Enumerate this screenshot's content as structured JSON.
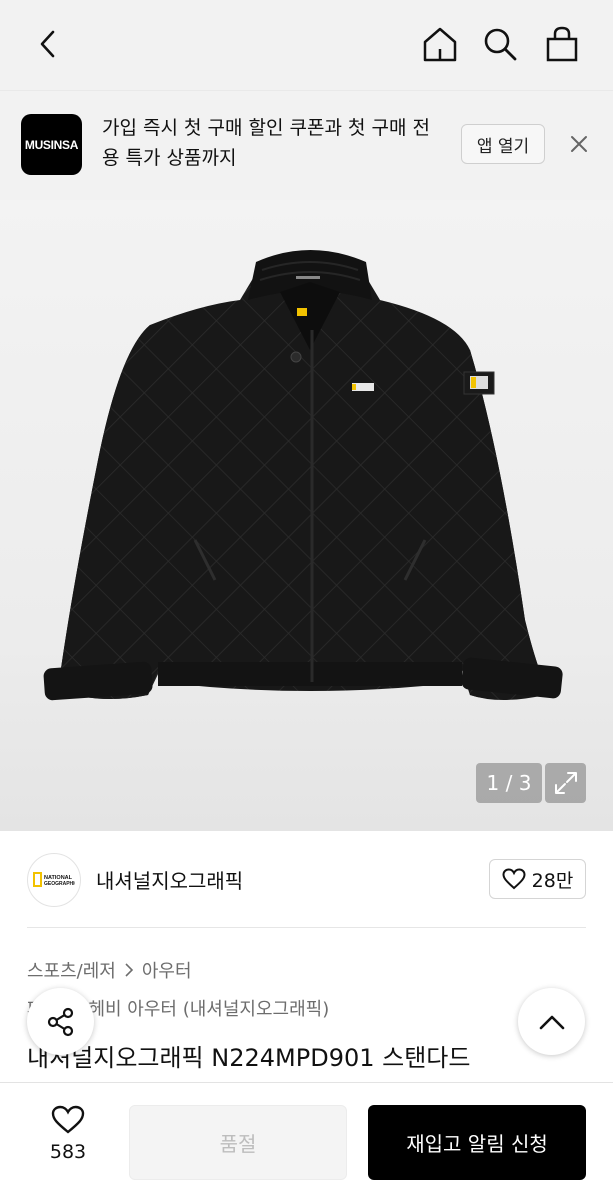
{
  "banner": {
    "logo_text": "MUSINSA",
    "text": "가입 즉시 첫 구매 할인 쿠폰과 첫 구매 전용 특가 상품까지",
    "open_label": "앱 열기"
  },
  "gallery": {
    "counter": "1 / 3"
  },
  "brand": {
    "name": "내셔널지오그래픽",
    "logo_text": "NATIONAL GEOGRAPHIC",
    "likes": "28만"
  },
  "breadcrumb": {
    "category": "스포츠/레저",
    "subcategory": "아우터"
  },
  "product": {
    "subtitle_visible": "패딩/숏 헤비 아우터 (내셔널지오그래픽)",
    "title": "내셔널지오그래픽 N224MPD901 스탠다드"
  },
  "bottom_bar": {
    "wish_count": "583",
    "soldout_label": "품절",
    "restock_label": "재입고 알림 신청"
  },
  "icons": {
    "back": "chevron-left-icon",
    "home": "home-icon",
    "search": "search-icon",
    "cart": "shopping-bag-icon",
    "close": "close-icon",
    "expand": "expand-icon",
    "heart": "heart-icon",
    "share": "share-icon",
    "scroll_top": "chevron-up-icon"
  },
  "colors": {
    "primary_button": "#000000",
    "disabled_button": "#f4f4f4",
    "header_bg": "#f2f2f2"
  }
}
